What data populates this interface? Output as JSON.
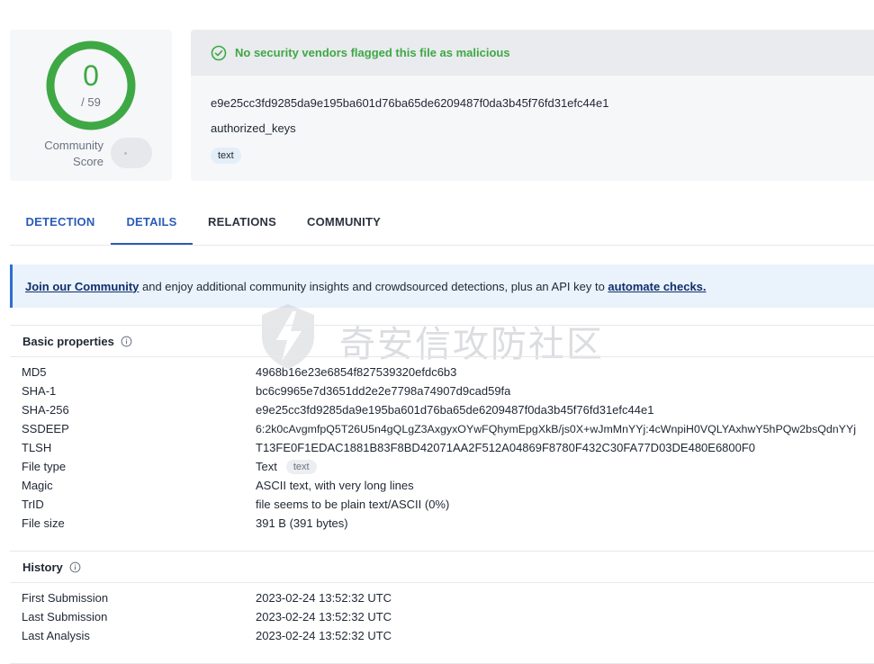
{
  "score": {
    "detections": "0",
    "total": "/ 59",
    "community_label_line1": "Community",
    "community_label_line2": "Score",
    "ring_color": "#3ea845"
  },
  "file_info": {
    "status_message": "No security vendors flagged this file as malicious",
    "hash": "e9e25cc3fd9285da9e195ba601d76ba65de6209487f0da3b45f76fd31efc44e1",
    "name": "authorized_keys",
    "tag": "text"
  },
  "tabs": [
    {
      "label": "DETECTION",
      "active": false
    },
    {
      "label": "DETAILS",
      "active": true
    },
    {
      "label": "RELATIONS",
      "active": false
    },
    {
      "label": "COMMUNITY",
      "active": false
    }
  ],
  "join_banner": {
    "link1": "Join our Community",
    "middle": " and enjoy additional community insights and crowdsourced detections, plus an API key to ",
    "link2": "automate checks."
  },
  "basic_properties": {
    "title": "Basic properties",
    "rows": [
      {
        "key": "MD5",
        "value": "4968b16e23e6854f827539320efdc6b3"
      },
      {
        "key": "SHA-1",
        "value": "bc6c9965e7d3651dd2e2e7798a74907d9cad59fa"
      },
      {
        "key": "SHA-256",
        "value": "e9e25cc3fd9285da9e195ba601d76ba65de6209487f0da3b45f76fd31efc44e1"
      },
      {
        "key": "SSDEEP",
        "value": "6:2k0cAvgmfpQ5T26U5n4gQLgZ3AxgyxOYwFQhymEpgXkB/js0X+wJmMnYYj:4cWnpiH0VQLYAxhwY5hPQw2bsQdnYYj"
      },
      {
        "key": "TLSH",
        "value": "T13FE0F1EDAC1881B83F8BD42071AA2F512A04869F8780F432C30FA77D03DE480E6800F0"
      },
      {
        "key": "File type",
        "value": "Text",
        "chip": "text"
      },
      {
        "key": "Magic",
        "value": "ASCII text, with very long lines"
      },
      {
        "key": "TrID",
        "value": "file seems to be plain text/ASCII (0%)"
      },
      {
        "key": "File size",
        "value": "391 B (391 bytes)"
      }
    ]
  },
  "history": {
    "title": "History",
    "rows": [
      {
        "key": "First Submission",
        "value": "2023-02-24 13:52:32 UTC"
      },
      {
        "key": "Last Submission",
        "value": "2023-02-24 13:52:32 UTC"
      },
      {
        "key": "Last Analysis",
        "value": "2023-02-24 13:52:32 UTC"
      }
    ]
  },
  "watermark": {
    "text": "奇安信攻防社区"
  },
  "colors": {
    "accent_blue": "#2a5bb8",
    "success_green": "#3ea845"
  }
}
